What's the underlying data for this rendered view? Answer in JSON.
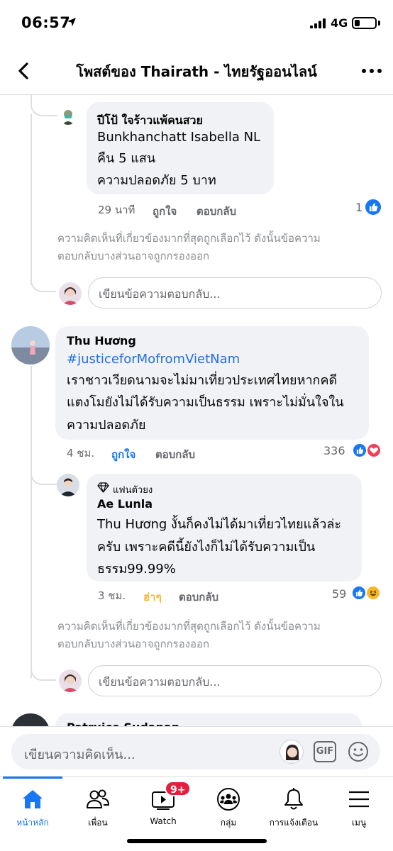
{
  "status_bar": {
    "time": "06:57",
    "network": "4G"
  },
  "header": {
    "title": "โพสต์ของ Thairath - ไทยรัฐออนไลน์"
  },
  "comments": [
    {
      "name": "ปีโป้ ใจร้าวแพ้คนสวย",
      "lines": [
        "Bunkhanchatt Isabella NL",
        "คืน 5 แสน",
        "ความปลอดภัย 5 บาท"
      ],
      "time": "29 นาที",
      "like_label": "ถูกใจ",
      "reply_label": "ตอบกลับ",
      "reaction_count": "1"
    },
    {
      "name": "Thu Hương",
      "hashtag": "#justiceforMofromVietNam",
      "lines": [
        "เราชาวเวียดนามจะไม่มาเที่ยวประเทศไทยหากคดี",
        "แตงโมยังไม่ได้รับความเป็นธรรม เพราะไม่มั่นใจใน",
        "ความปลอดภัย"
      ],
      "time": "4 ชม.",
      "like_label": "ถูกใจ",
      "reply_label": "ตอบกลับ",
      "reaction_count": "336"
    },
    {
      "badge": "แฟนตัวยง",
      "name": "Ae Lunla",
      "lines": [
        "Thu Hương งั้นก็คงไม่ได้มาเที่ยวไทยแล้วล่ะ",
        "ครับ เพราะคดีนี้ยังไงก็ไม่ได้รับความเป็น",
        "ธรรม99.99%"
      ],
      "time": "3 ชม.",
      "like_label": "ฮ่าๆ",
      "reply_label": "ตอบกลับ",
      "reaction_count": "59"
    },
    {
      "name": "Patruice Sudapan"
    }
  ],
  "filter_note_lines": [
    "ความคิดเห็นที่เกี่ยวข้องมากที่สุดถูกเลือกไว้ ดังนั้นข้อความ",
    "ตอบกลับบางส่วนอาจถูกกรองออก"
  ],
  "reply_placeholder": "เขียนข้อความตอบกลับ...",
  "composer": {
    "placeholder": "เขียนความคิดเห็น...",
    "gif_label": "GIF"
  },
  "tabbar": {
    "items": [
      {
        "label": "หน้าหลัก",
        "icon": "home-icon"
      },
      {
        "label": "เพื่อน",
        "icon": "friends-icon"
      },
      {
        "label": "Watch",
        "icon": "watch-icon"
      },
      {
        "label": "กลุ่ม",
        "icon": "groups-icon"
      },
      {
        "label": "การแจ้งเตือน",
        "icon": "bell-icon"
      },
      {
        "label": "เมนู",
        "icon": "menu-icon"
      }
    ],
    "watch_badge": "9+"
  },
  "colors": {
    "accent": "#1877f2",
    "badge": "#e41e3f",
    "bubble": "#f0f2f5",
    "love": "#f33e58",
    "haha": "#f7b928"
  }
}
